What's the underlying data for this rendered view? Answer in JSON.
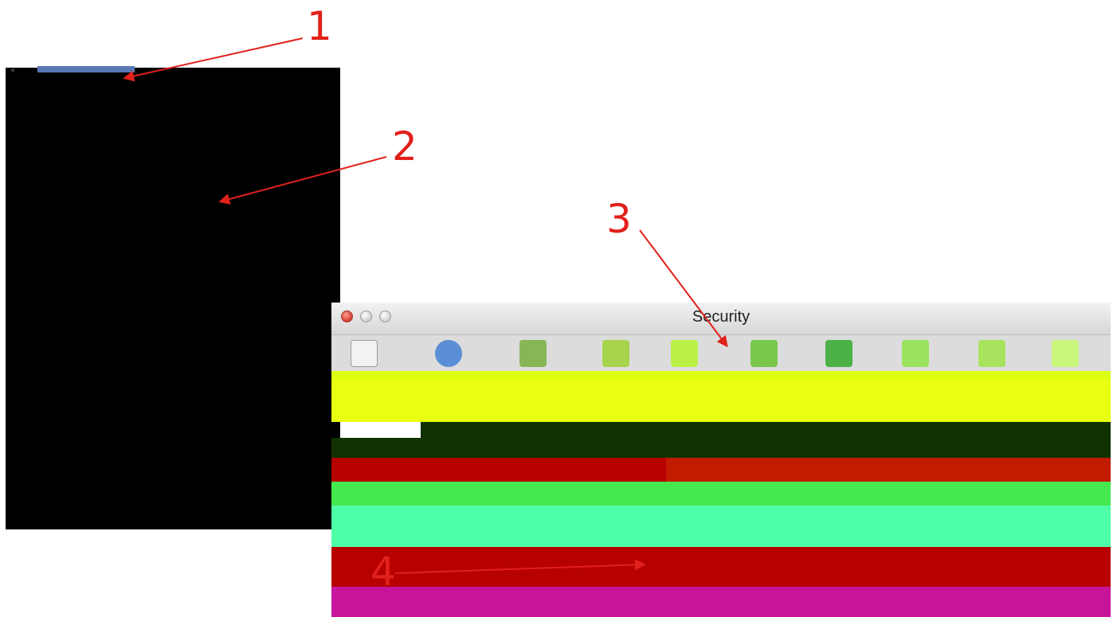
{
  "window": {
    "title": "Security"
  },
  "annotations": [
    "1",
    "2",
    "3",
    "4"
  ],
  "colors": {
    "annotation": "#e1211b",
    "window_chrome": "#dcdcdc",
    "glitch_yellow": "#e8ff12",
    "glitch_green": "#45e84f",
    "glitch_red": "#b70000",
    "glitch_teal": "#4dffa6",
    "glitch_magenta": "#c8149b"
  },
  "toolbar": {
    "icons": [
      "general-icon",
      "web-icon",
      "tabs-icon",
      "autofill-icon",
      "passwords-icon",
      "security-icon",
      "privacy-icon",
      "notifications-icon",
      "extensions-icon",
      "advanced-icon"
    ]
  }
}
